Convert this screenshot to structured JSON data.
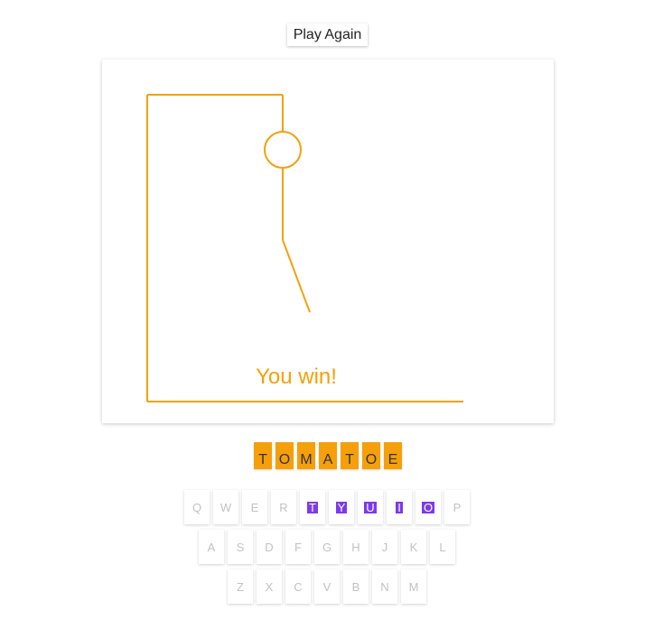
{
  "play_again_label": "Play Again",
  "result_text": "You win!",
  "colors": {
    "accent": "#F5A00A",
    "used_key": "#7C3AED"
  },
  "word": [
    "T",
    "O",
    "M",
    "A",
    "T",
    "O",
    "E"
  ],
  "keyboard": {
    "rows": [
      [
        {
          "label": "Q",
          "used": false
        },
        {
          "label": "W",
          "used": false
        },
        {
          "label": "E",
          "used": false
        },
        {
          "label": "R",
          "used": false
        },
        {
          "label": "T",
          "used": true
        },
        {
          "label": "Y",
          "used": true
        },
        {
          "label": "U",
          "used": true
        },
        {
          "label": "I",
          "used": true
        },
        {
          "label": "O",
          "used": true
        },
        {
          "label": "P",
          "used": false
        }
      ],
      [
        {
          "label": "A",
          "used": false
        },
        {
          "label": "S",
          "used": false
        },
        {
          "label": "D",
          "used": false
        },
        {
          "label": "F",
          "used": false
        },
        {
          "label": "G",
          "used": false
        },
        {
          "label": "H",
          "used": false
        },
        {
          "label": "J",
          "used": false
        },
        {
          "label": "K",
          "used": false
        },
        {
          "label": "L",
          "used": false
        }
      ],
      [
        {
          "label": "Z",
          "used": false
        },
        {
          "label": "X",
          "used": false
        },
        {
          "label": "C",
          "used": false
        },
        {
          "label": "V",
          "used": false
        },
        {
          "label": "B",
          "used": false
        },
        {
          "label": "N",
          "used": false
        },
        {
          "label": "M",
          "used": false
        }
      ]
    ]
  }
}
